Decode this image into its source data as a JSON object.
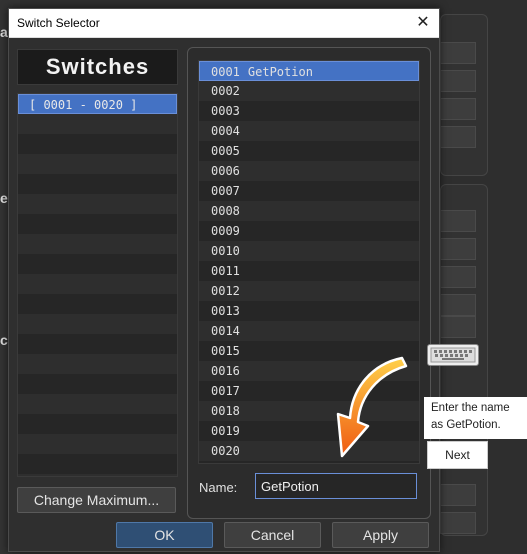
{
  "dialog": {
    "title": "Switch Selector",
    "close_glyph": "✕",
    "header": "Switches",
    "groups": [
      "[ 0001 - 0020 ]"
    ],
    "change_max_label": "Change Maximum...",
    "switches": [
      {
        "id": "0001",
        "name": "GetPotion"
      },
      {
        "id": "0002",
        "name": ""
      },
      {
        "id": "0003",
        "name": ""
      },
      {
        "id": "0004",
        "name": ""
      },
      {
        "id": "0005",
        "name": ""
      },
      {
        "id": "0006",
        "name": ""
      },
      {
        "id": "0007",
        "name": ""
      },
      {
        "id": "0008",
        "name": ""
      },
      {
        "id": "0009",
        "name": ""
      },
      {
        "id": "0010",
        "name": ""
      },
      {
        "id": "0011",
        "name": ""
      },
      {
        "id": "0012",
        "name": ""
      },
      {
        "id": "0013",
        "name": ""
      },
      {
        "id": "0014",
        "name": ""
      },
      {
        "id": "0015",
        "name": ""
      },
      {
        "id": "0016",
        "name": ""
      },
      {
        "id": "0017",
        "name": ""
      },
      {
        "id": "0018",
        "name": ""
      },
      {
        "id": "0019",
        "name": ""
      },
      {
        "id": "0020",
        "name": ""
      }
    ],
    "name_label": "Name:",
    "name_value": "GetPotion",
    "ok_label": "OK",
    "cancel_label": "Cancel",
    "apply_label": "Apply"
  },
  "tutorial": {
    "tip_line1": "Enter the name",
    "tip_line2": "as GetPotion.",
    "next_label": "Next",
    "arrow_color": "#f08a1e"
  },
  "background": {
    "fragments": [
      "a",
      "e",
      "c"
    ]
  },
  "colors": {
    "selection": "#4472c4",
    "ok_button": "#2f4f74"
  }
}
